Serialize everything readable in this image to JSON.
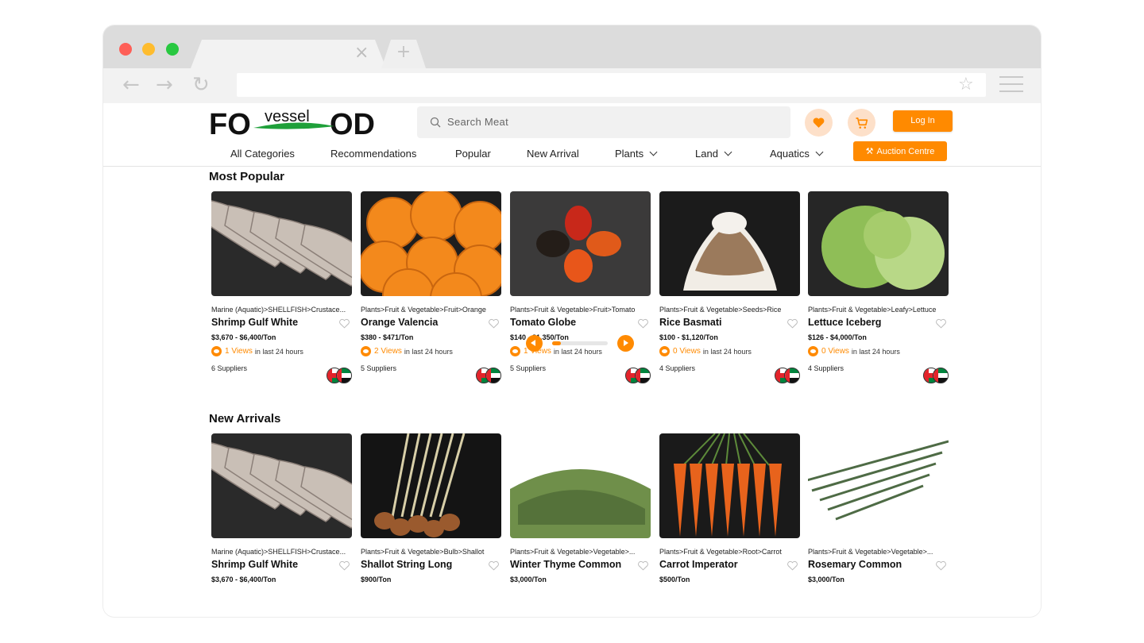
{
  "brand": {
    "logo_text": "FOvesselOD",
    "accent": "#ff8a00"
  },
  "search": {
    "placeholder": "Search Meat"
  },
  "header": {
    "login_label": "Log In",
    "auction_label": "Auction Centre"
  },
  "nav": {
    "items": [
      {
        "label": "All Categories"
      },
      {
        "label": "Recommendations"
      },
      {
        "label": "Popular"
      },
      {
        "label": "New Arrival"
      },
      {
        "label": "Plants"
      },
      {
        "label": "Land"
      },
      {
        "label": "Aquatics"
      }
    ]
  },
  "most_popular": {
    "title": "Most Popular",
    "pager_progress": 0.15,
    "cards": [
      {
        "category": "Marine (Aquatic)>SHELLFISH>Crustace...",
        "name": "Shrimp Gulf White",
        "price": "$3,670 - $6,400/Ton",
        "views": "1 Views",
        "views_suffix": "in last 24 hours",
        "suppliers": "6 Suppliers",
        "image": "shrimp"
      },
      {
        "category": "Plants>Fruit & Vegetable>Fruit>Orange",
        "name": "Orange Valencia",
        "price": "$380 - $471/Ton",
        "views": "2 Views",
        "views_suffix": "in last 24 hours",
        "suppliers": "5 Suppliers",
        "image": "orange"
      },
      {
        "category": "Plants>Fruit & Vegetable>Fruit>Tomato",
        "name": "Tomato Globe",
        "price": "$140 - $1,350/Ton",
        "views": "1 Views",
        "views_suffix": "in last 24 hours",
        "suppliers": "5 Suppliers",
        "image": "tomato"
      },
      {
        "category": "Plants>Fruit & Vegetable>Seeds>Rice",
        "name": "Rice Basmati",
        "price": "$100 - $1,120/Ton",
        "views": "0 Views",
        "views_suffix": "in last 24 hours",
        "suppliers": "4 Suppliers",
        "image": "rice"
      },
      {
        "category": "Plants>Fruit & Vegetable>Leafy>Lettuce",
        "name": "Lettuce Iceberg",
        "price": "$126 - $4,000/Ton",
        "views": "0 Views",
        "views_suffix": "in last 24 hours",
        "suppliers": "4 Suppliers",
        "image": "lettuce"
      }
    ]
  },
  "new_arrivals": {
    "title": "New Arrivals",
    "cards": [
      {
        "category": "Marine (Aquatic)>SHELLFISH>Crustace...",
        "name": "Shrimp Gulf White",
        "price": "$3,670 - $6,400/Ton",
        "image": "shrimp"
      },
      {
        "category": "Plants>Fruit & Vegetable>Bulb>Shallot",
        "name": "Shallot String Long",
        "price": "$900/Ton",
        "image": "shallot"
      },
      {
        "category": "Plants>Fruit & Vegetable>Vegetable>...",
        "name": "Winter Thyme Common",
        "price": "$3,000/Ton",
        "image": "thyme"
      },
      {
        "category": "Plants>Fruit & Vegetable>Root>Carrot",
        "name": "Carrot Imperator",
        "price": "$500/Ton",
        "image": "carrot"
      },
      {
        "category": "Plants>Fruit & Vegetable>Vegetable>...",
        "name": "Rosemary Common",
        "price": "$3,000/Ton",
        "image": "rosemary"
      }
    ]
  }
}
